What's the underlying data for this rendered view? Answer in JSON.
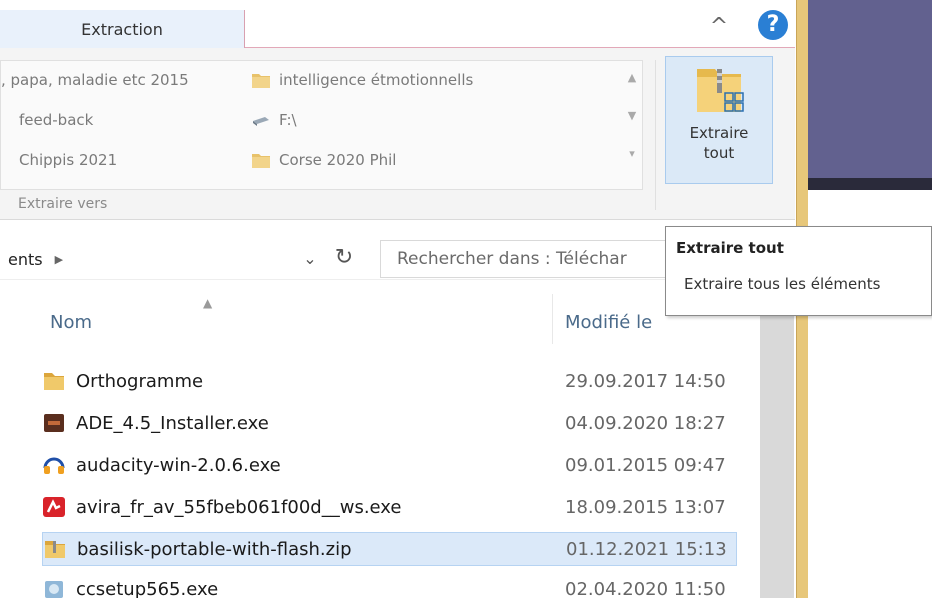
{
  "ribbon": {
    "tab_label": "Extraction",
    "gallery": [
      ", papa, maladie etc 2015",
      "intelligence étmotionnells",
      "feed-back",
      "F:\\",
      "Chippis 2021",
      "Corse 2020 Phil"
    ],
    "group_label": "Extraire vers",
    "extract_all": "Extraire tout"
  },
  "address": {
    "path_segment": "ents",
    "search_placeholder": "Rechercher dans : Téléchar"
  },
  "columns": {
    "name": "Nom",
    "modified": "Modifié le"
  },
  "files": [
    {
      "name": "Orthogramme",
      "date": "29.09.2017 14:50",
      "icon": "folder-icon"
    },
    {
      "name": "ADE_4.5_Installer.exe",
      "date": "04.09.2020 18:27",
      "icon": "installer-icon"
    },
    {
      "name": "audacity-win-2.0.6.exe",
      "date": "09.01.2015 09:47",
      "icon": "audacity-icon"
    },
    {
      "name": "avira_fr_av_55fbeb061f00d__ws.exe",
      "date": "18.09.2015 13:07",
      "icon": "avira-icon"
    },
    {
      "name": "basilisk-portable-with-flash.zip",
      "date": "01.12.2021 15:13",
      "icon": "zip-folder-icon"
    },
    {
      "name": "ccsetup565.exe",
      "date": "02.04.2020 11:50",
      "icon": "ccleaner-icon"
    }
  ],
  "tooltip": {
    "title": "Extraire tout",
    "description": "Extraire tous les éléments"
  }
}
